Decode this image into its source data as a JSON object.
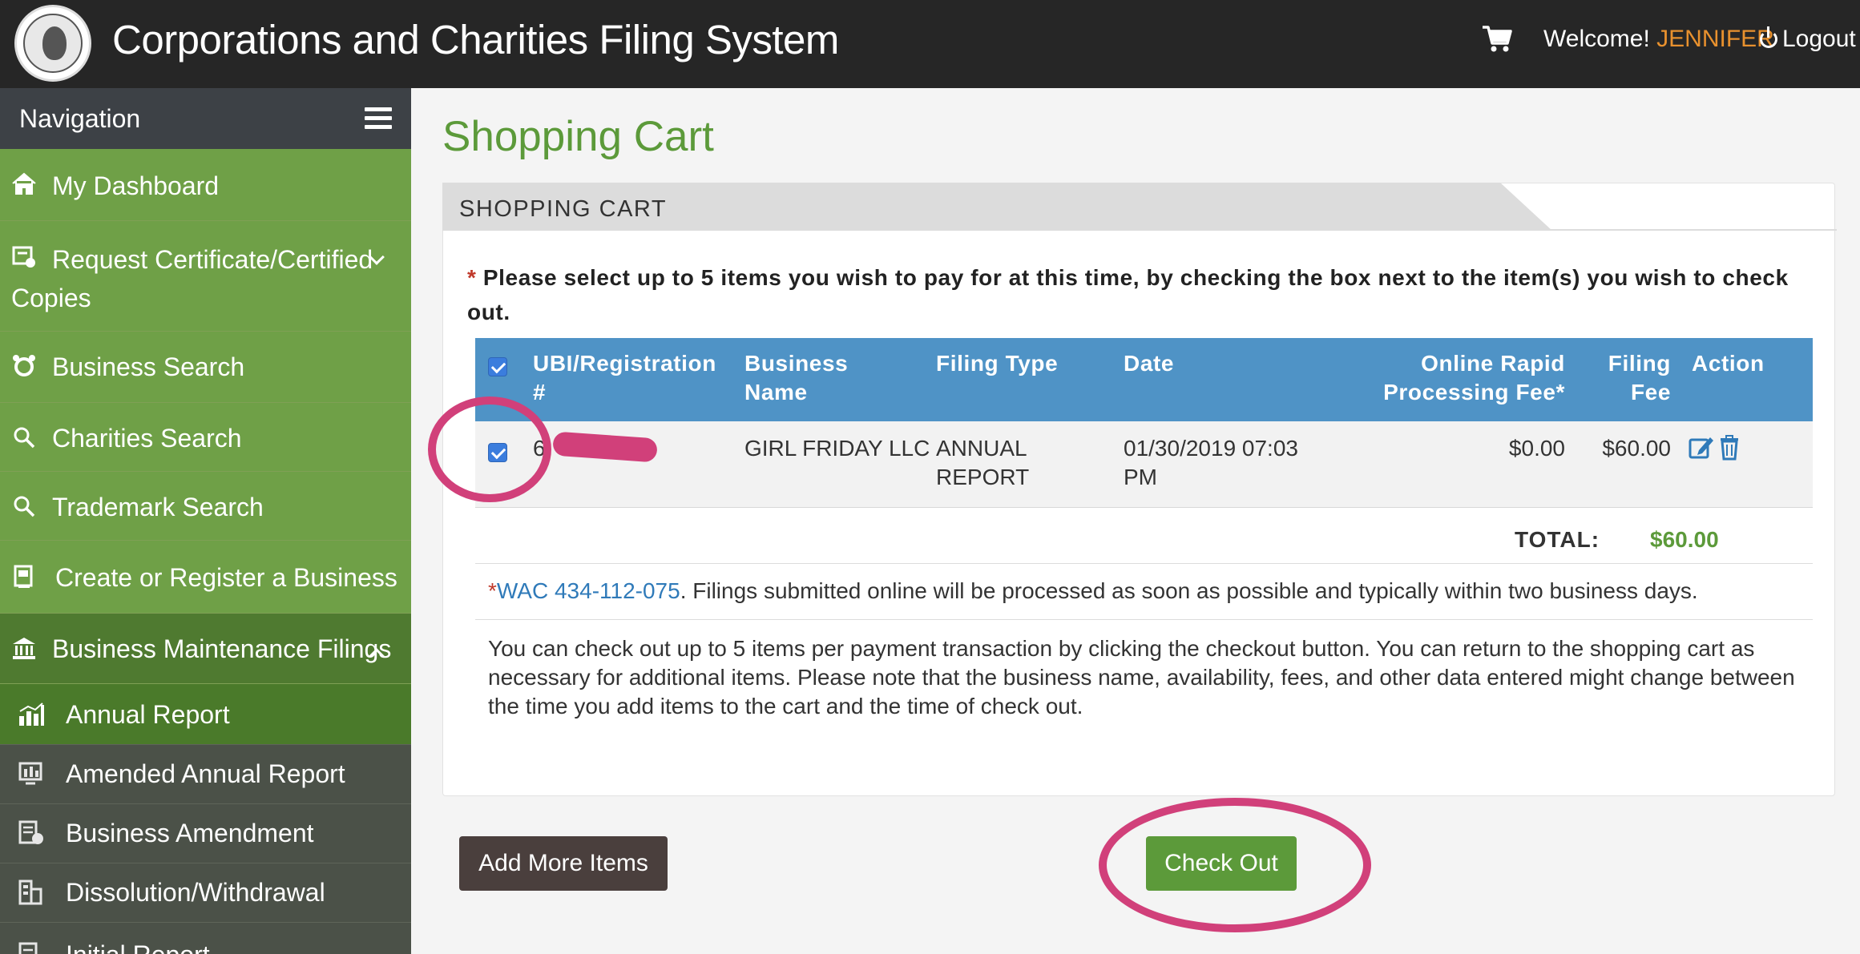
{
  "header": {
    "app_title": "Corporations and Charities Filing System",
    "welcome_label": "Welcome!",
    "user_name": "JENNIFER",
    "logout_label": "Logout"
  },
  "sidebar": {
    "title": "Navigation",
    "items": [
      {
        "label": "My Dashboard",
        "icon": "home-icon"
      },
      {
        "label_line1": "Request Certificate/Certified",
        "label_line2": "Copies",
        "icon": "certificate-icon"
      },
      {
        "label": "Business Search",
        "icon": "business-search-icon"
      },
      {
        "label": "Charities Search",
        "icon": "search-icon"
      },
      {
        "label": "Trademark Search",
        "icon": "search-icon"
      },
      {
        "label": "Create or Register a Business",
        "icon": "register-icon"
      },
      {
        "label": "Business Maintenance Filings",
        "icon": "bank-icon"
      }
    ],
    "subitems": [
      {
        "label": "Annual Report",
        "icon": "chart-icon"
      },
      {
        "label": "Amended Annual Report",
        "icon": "amended-report-icon"
      },
      {
        "label": "Business Amendment",
        "icon": "amendment-icon"
      },
      {
        "label": "Dissolution/Withdrawal",
        "icon": "dissolution-icon"
      },
      {
        "label": "Initial Report",
        "icon": "report-icon"
      }
    ]
  },
  "main": {
    "page_title": "Shopping Cart",
    "panel_title": "SHOPPING CART",
    "required_mark": "*",
    "instructions": "Please select up to 5 items you wish to pay for at this time, by checking the box next to the item(s) you wish to check out.",
    "table": {
      "headers": {
        "ubi_line1": "UBI/Registration",
        "ubi_line2": "#",
        "name_line1": "Business",
        "name_line2": "Name",
        "filing_type": "Filing Type",
        "date": "Date",
        "fee_line1": "Online Rapid",
        "fee_line2": "Processing Fee*",
        "filing_fee_line1": "Filing",
        "filing_fee_line2": "Fee",
        "action": "Action"
      },
      "rows": [
        {
          "ubi": "6",
          "business_name": "GIRL FRIDAY LLC",
          "filing_type_line1": "ANNUAL",
          "filing_type_line2": "REPORT",
          "date_line1": "01/30/2019 07:03",
          "date_line2": "PM",
          "processing_fee": "$0.00",
          "filing_fee": "$60.00",
          "checked": true
        }
      ],
      "total_label": "TOTAL:",
      "total_value": "$60.00"
    },
    "wac_mark": "*",
    "wac_link": "WAC 434-112-075",
    "wac_text": ". Filings submitted online will be processed as soon as possible and typically within two business days.",
    "note": "You can check out up to 5 items per payment transaction by clicking the checkout button. You can return to the shopping cart as necessary for additional items. Please note that the business name, availability, fees, and other data entered might change between the time you add items to the cart and the time of check out.",
    "add_more_label": "Add More Items",
    "checkout_label": "Check Out"
  },
  "colors": {
    "header_bg": "#262626",
    "sidebar_green": "#6fa047",
    "sidebar_dark": "#4b5148",
    "accent_green": "#5c9a3a",
    "table_blue": "#4f93c6",
    "user_orange": "#e8912e",
    "annotation_pink": "#d1407a"
  }
}
